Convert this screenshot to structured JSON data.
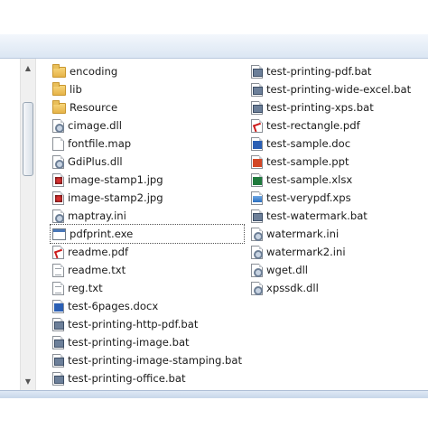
{
  "left_column": [
    {
      "name": "encoding",
      "icon": "folder-icon"
    },
    {
      "name": "lib",
      "icon": "folder-icon"
    },
    {
      "name": "Resource",
      "icon": "folder-icon"
    },
    {
      "name": "cimage.dll",
      "icon": "dll-file-icon"
    },
    {
      "name": "fontfile.map",
      "icon": "blank-file-icon"
    },
    {
      "name": "GdiPlus.dll",
      "icon": "dll-file-icon"
    },
    {
      "name": "image-stamp1.jpg",
      "icon": "jpg-file-icon"
    },
    {
      "name": "image-stamp2.jpg",
      "icon": "jpg-file-icon"
    },
    {
      "name": "maptray.ini",
      "icon": "ini-file-icon"
    },
    {
      "name": "pdfprint.exe",
      "icon": "exe-file-icon"
    },
    {
      "name": "readme.pdf",
      "icon": "pdf-file-icon"
    },
    {
      "name": "readme.txt",
      "icon": "txt-file-icon"
    },
    {
      "name": "reg.txt",
      "icon": "txt-file-icon"
    },
    {
      "name": "test-6pages.docx",
      "icon": "docx-file-icon"
    },
    {
      "name": "test-printing-http-pdf.bat",
      "icon": "bat-file-icon"
    },
    {
      "name": "test-printing-image.bat",
      "icon": "bat-file-icon"
    },
    {
      "name": "test-printing-image-stamping.bat",
      "icon": "bat-file-icon"
    },
    {
      "name": "test-printing-office.bat",
      "icon": "bat-file-icon"
    }
  ],
  "right_column": [
    {
      "name": "test-printing-pdf.bat",
      "icon": "bat-file-icon"
    },
    {
      "name": "test-printing-wide-excel.bat",
      "icon": "bat-file-icon"
    },
    {
      "name": "test-printing-xps.bat",
      "icon": "bat-file-icon"
    },
    {
      "name": "test-rectangle.pdf",
      "icon": "pdf-file-icon"
    },
    {
      "name": "test-sample.doc",
      "icon": "doc-file-icon"
    },
    {
      "name": "test-sample.ppt",
      "icon": "ppt-file-icon"
    },
    {
      "name": "test-sample.xlsx",
      "icon": "xlsx-file-icon"
    },
    {
      "name": "test-verypdf.xps",
      "icon": "xps-file-icon"
    },
    {
      "name": "test-watermark.bat",
      "icon": "bat-file-icon"
    },
    {
      "name": "watermark.ini",
      "icon": "ini-file-icon"
    },
    {
      "name": "watermark2.ini",
      "icon": "ini-file-icon"
    },
    {
      "name": "wget.dll",
      "icon": "dll-file-icon"
    },
    {
      "name": "xpssdk.dll",
      "icon": "dll-file-icon"
    }
  ],
  "focused_item": "pdfprint.exe",
  "scrollbar": {
    "up_arrow": "▲",
    "down_arrow": "▼"
  },
  "colors": {
    "chrome_blue": "#dbe6f3",
    "folder": "#e6b348",
    "text": "#1b1b1b"
  }
}
